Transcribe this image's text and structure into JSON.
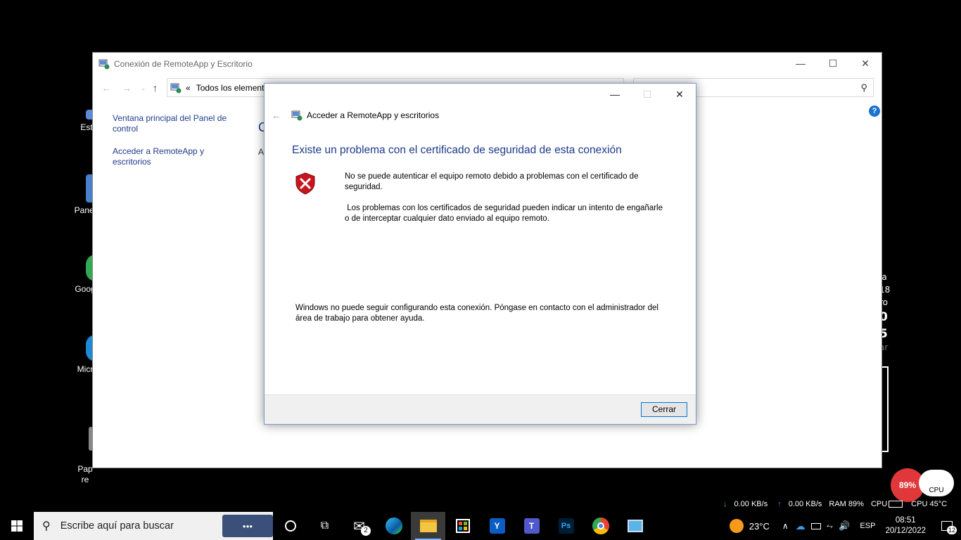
{
  "desktop": {
    "icons": [
      {
        "label": "Est"
      },
      {
        "label": "Panel"
      },
      {
        "label": "Goog"
      },
      {
        "label": "Micr"
      },
      {
        "label": "Pap\nre"
      }
    ],
    "right_fragments": [
      "ía",
      "18",
      "ro",
      "0",
      "5",
      "ar"
    ]
  },
  "control_panel": {
    "title": "Conexión de RemoteApp y Escritorio",
    "address": "Todos los elemento",
    "sidebar": [
      "Ventana principal del Panel de control",
      "Acceder a RemoteApp y escritorios"
    ],
    "heading_fragment": "C",
    "body_fragment": "A"
  },
  "dialog": {
    "title": "Acceder a RemoteApp y escritorios",
    "main_title": "Existe un problema con el certificado de seguridad de esta conexión",
    "message1": "No se puede autenticar el equipo remoto debido a problemas con el certificado de seguridad.",
    "message2": " Los problemas con los certificados de seguridad pueden indicar un intento de engañarle o de interceptar cualquier dato enviado al equipo remoto.",
    "message3": "Windows no puede seguir configurando esta conexión. Póngase en contacto con el administrador del área de trabajo para obtener ayuda.",
    "close_label": "Cerrar"
  },
  "perf": {
    "ram_percent": "89%",
    "cpu_label": "CPU",
    "down": "0.00 KB/s",
    "up": "0.00 KB/s",
    "ram": "RAM 89%",
    "cpu": "CPU",
    "cpu_temp": "CPU 45°C"
  },
  "taskbar": {
    "search_placeholder": "Escribe aquí para buscar",
    "mail_badge": "2",
    "temperature": "23°C",
    "language": "ESP",
    "time": "08:51",
    "date": "20/12/2022",
    "notification_count": "12"
  }
}
